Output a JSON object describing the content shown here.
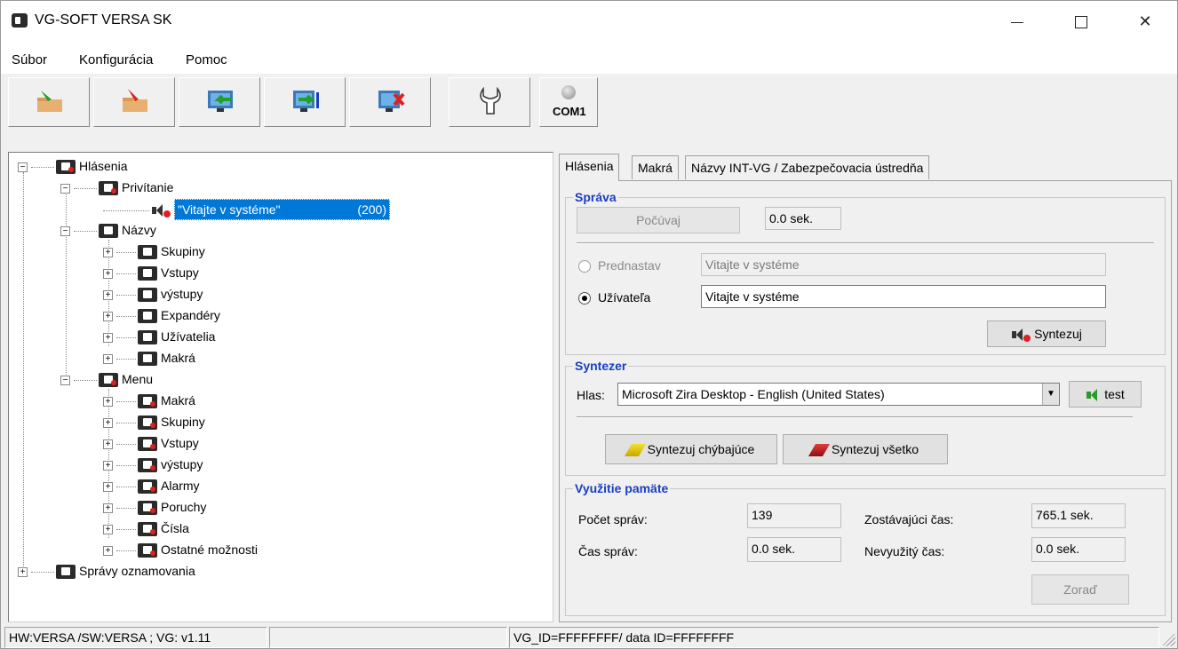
{
  "window": {
    "title": "VG-SOFT VERSA SK"
  },
  "menu": {
    "items": [
      "Súbor",
      "Konfigurácia",
      "Pomoc"
    ]
  },
  "toolbar": {
    "buttons": [
      "upload-icon",
      "download-icon",
      "read-from-device-icon",
      "write-to-device-icon",
      "disconnect-icon",
      "settings-wrench-icon"
    ],
    "com_label": "COM1"
  },
  "tree": {
    "root": "Hlásenia",
    "privitanie": "Privítanie",
    "selected_item": "\"Vitajte v systéme\"",
    "selected_num": "(200)",
    "nazvy": "Názvy",
    "nazvy_children": [
      "Skupiny",
      "Vstupy",
      "výstupy",
      "Expandéry",
      "Užívatelia",
      "Makrá"
    ],
    "menu": "Menu",
    "menu_children": [
      "Makrá",
      "Skupiny",
      "Vstupy",
      "výstupy",
      "Alarmy",
      "Poruchy",
      "Čísla",
      "Ostatné možnosti"
    ],
    "spravy": "Správy oznamovania"
  },
  "tabs": [
    "Hlásenia",
    "Makrá",
    "Názvy INT-VG / Zabezpečovacia ústredňa"
  ],
  "sprava": {
    "title": "Správa",
    "play_button": "Počúvaj",
    "duration": "0.0 sek.",
    "default_label": "Prednastav",
    "default_value": "Vitajte v systéme",
    "user_label": "Užívateľa",
    "user_value": "Vitajte v systéme",
    "synthesize_button": "Syntezuj"
  },
  "syntezer": {
    "title": "Syntezer",
    "voice_label": "Hlas:",
    "voice_value": "Microsoft Zira Desktop - English (United States)",
    "test_button": "test",
    "missing_button": "Syntezuj chýbajúce",
    "all_button": "Syntezuj všetko"
  },
  "memory": {
    "title": "Využitie pamäte",
    "count_label": "Počet správ:",
    "count_value": "139",
    "remaining_label": "Zostávajúci čas:",
    "remaining_value": "765.1 sek.",
    "time_label": "Čas správ:",
    "time_value": "0.0 sek.",
    "unused_label": "Nevyužitý čas:",
    "unused_value": "0.0 sek.",
    "sort_button": "Zoraď"
  },
  "status": {
    "hw": "HW:VERSA /SW:VERSA ; VG: v1.11",
    "empty": "",
    "ids": "VG_ID=FFFFFFFF/ data ID=FFFFFFFF"
  }
}
